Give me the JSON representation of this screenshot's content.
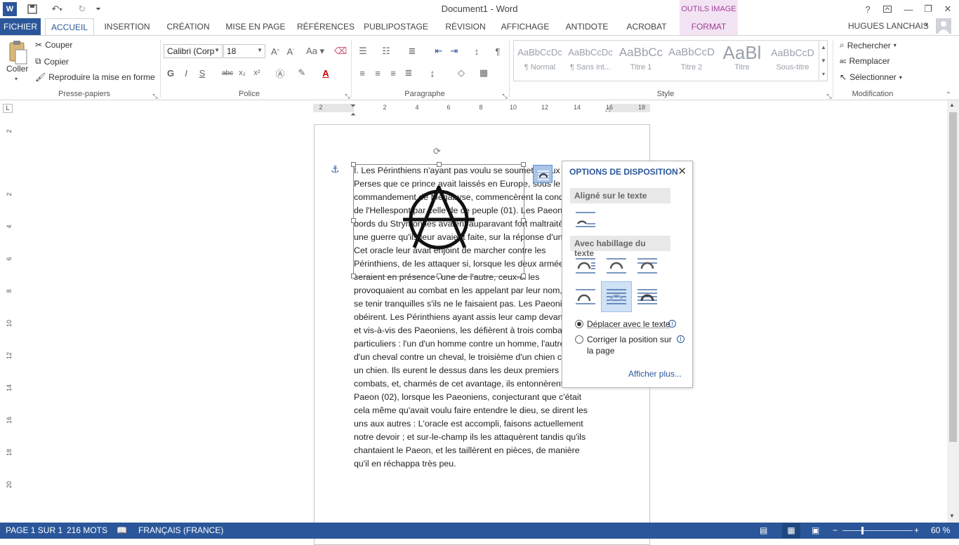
{
  "window": {
    "title": "Document1 - Word",
    "help": "?",
    "contextual_group": "OUTILS IMAGE",
    "user": "HUGUES LANCHAIS"
  },
  "tabs": [
    {
      "label": "FICHIER"
    },
    {
      "label": "ACCUEIL"
    },
    {
      "label": "INSERTION"
    },
    {
      "label": "CRÉATION"
    },
    {
      "label": "MISE EN PAGE"
    },
    {
      "label": "RÉFÉRENCES"
    },
    {
      "label": "PUBLIPOSTAGE"
    },
    {
      "label": "RÉVISION"
    },
    {
      "label": "AFFICHAGE"
    },
    {
      "label": "ANTIDOTE"
    },
    {
      "label": "ACROBAT"
    },
    {
      "label": "FORMAT"
    }
  ],
  "ribbon": {
    "clipboard": {
      "paste": "Coller",
      "cut": "Couper",
      "copy": "Copier",
      "format_painter": "Reproduire la mise en forme",
      "group": "Presse-papiers"
    },
    "font": {
      "font_name": "Calibri (Corp",
      "font_size": "18",
      "group": "Police",
      "bold": "G",
      "italic": "I",
      "underline": "S",
      "strike": "abc",
      "sub": "x₂",
      "sup": "x²"
    },
    "paragraph": {
      "group": "Paragraphe"
    },
    "styles": {
      "group": "Style",
      "items": [
        {
          "sample": "AaBbCcDc",
          "name": "¶ Normal"
        },
        {
          "sample": "AaBbCcDc",
          "name": "¶ Sans int..."
        },
        {
          "sample": "AaBbCc",
          "name": "Titre 1"
        },
        {
          "sample": "AaBbCcD",
          "name": "Titre 2"
        },
        {
          "sample": "AaBl",
          "name": "Titre"
        },
        {
          "sample": "AaBbCcD",
          "name": "Sous-titre"
        }
      ]
    },
    "editing": {
      "group": "Modification",
      "find": "Rechercher",
      "replace": "Remplacer",
      "select": "Sélectionner"
    }
  },
  "ruler": {
    "h_ticks": [
      "2",
      "2",
      "4",
      "6",
      "8",
      "10",
      "12",
      "14",
      "16",
      "18"
    ],
    "v_ticks": [
      "2",
      "2",
      "4",
      "6",
      "8",
      "10",
      "12",
      "14",
      "16",
      "18",
      "20"
    ]
  },
  "document": {
    "text": "I. Les Périnthiens n'ayant pas voulu se soumettre aux\nPerses que ce prince avait laissés en Europe, sous le\ncommandement de Mégabyse, commencèrent la conquête\nde l'Hellespont par celle de ce peuple (01). Les Paeoniens des\nbords du Strymon les avaient auparavant fort maltraités, dans\nune guerre qu'ils leur avaient faite, sur la réponse d'un oracle.\nCet oracle leur avait enjoint de marcher contre les\nPérinthiens, de les attaquer si, lorsque les deux armées\nseraient en présence l'une de l'autre, ceux-ci les\nprovoquaient au combat en les appelant par leur nom, et de\nse tenir tranquilles s'ils ne le faisaient pas. Les Paeoniens\nobéirent. Les Périnthiens ayant assis leur camp devant la ville\net vis-à-vis des Paeoniens, les défièrent à trois combats\nparticuliers : l'un d'un homme contre un homme, l'autre\nd'un cheval contre un cheval, le troisième d'un chien contre\nun chien. Ils eurent le dessus dans les deux premiers\ncombats, et, charmés de cet avantage, ils entonnèrent le\nPaeon (02), lorsque les Paeoniens, conjecturant que c'était\ncela même qu'avait voulu faire entendre le dieu, se dirent les\nuns aux autres : L'oracle est accompli, faisons actuellement\nnotre devoir ; et sur-le-champ ils les attaquèrent tandis qu'ils\nchantaient le Paeon, et les taillèrent en pièces, de manière\nqu'il en réchappa très peu."
  },
  "layout_options": {
    "title": "OPTIONS DE DISPOSITION",
    "inline_section": "Aligné sur le texte",
    "wrap_section": "Avec habillage du texte",
    "move_with_text": "Déplacer avec le texte",
    "fix_position": "Corriger la position sur",
    "fix_position_2": "la page",
    "see_more": "Afficher plus..."
  },
  "status": {
    "page": "PAGE 1 SUR 1",
    "words": "216 MOTS",
    "language": "FRANÇAIS (FRANCE)",
    "zoom": "60 %"
  },
  "colors": {
    "accent": "#2b579a",
    "context": "#a03e9a"
  }
}
